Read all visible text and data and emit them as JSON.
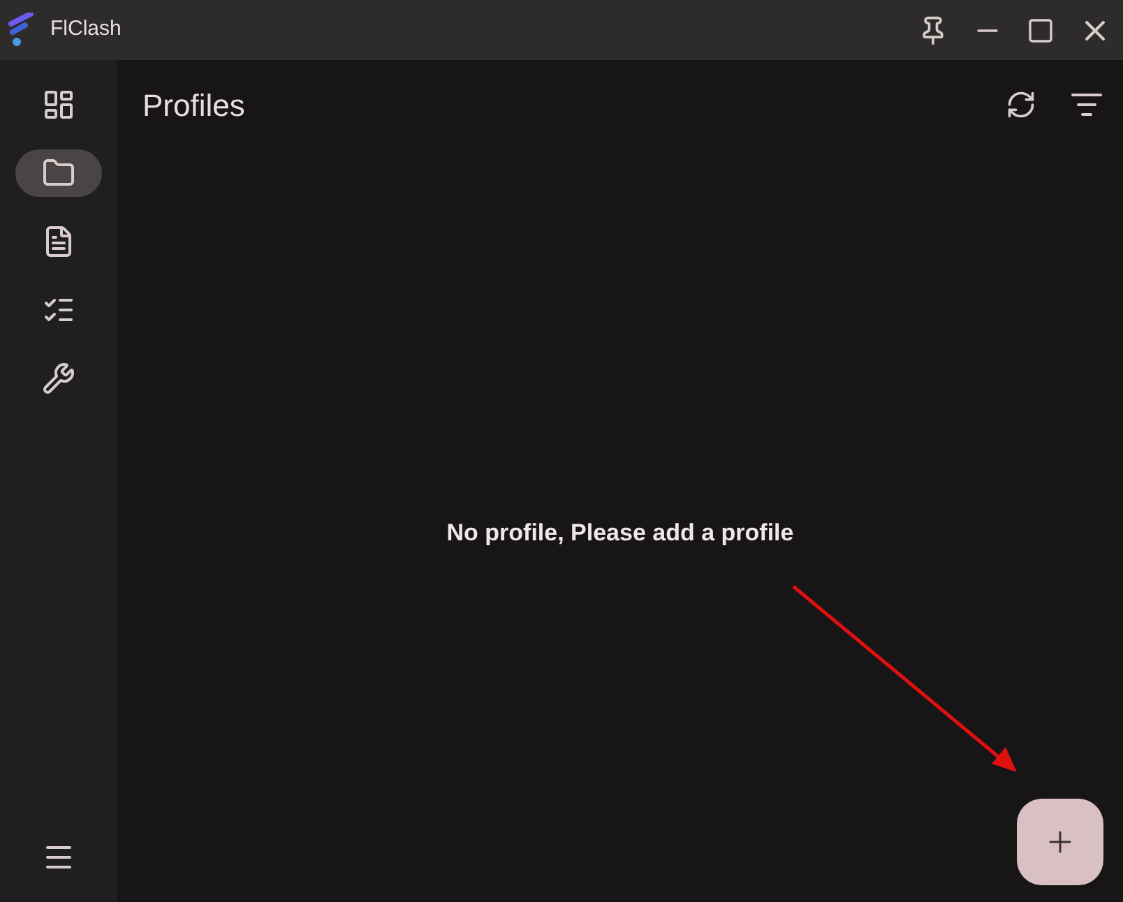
{
  "window": {
    "title": "FlClash"
  },
  "nav": [
    {
      "kind": "dashboard",
      "selected": false
    },
    {
      "kind": "profiles",
      "selected": true
    },
    {
      "kind": "requests",
      "selected": false
    },
    {
      "kind": "resources",
      "selected": false
    },
    {
      "kind": "tools",
      "selected": false
    }
  ],
  "page": {
    "title": "Profiles",
    "empty_message": "No profile, Please add a profile"
  }
}
